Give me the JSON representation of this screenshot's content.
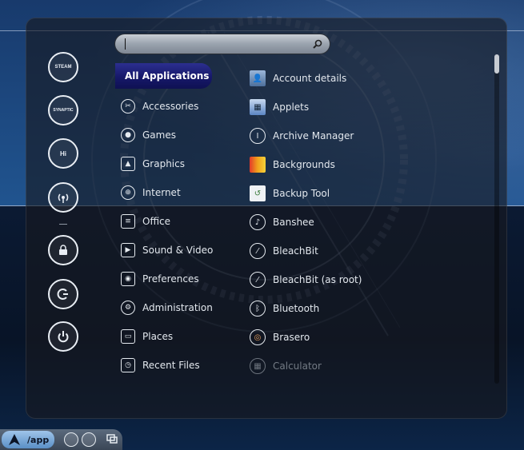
{
  "search": {
    "value": "",
    "placeholder": ""
  },
  "categories": [
    {
      "label": "All Applications",
      "icon": "all-apps",
      "selected": true
    },
    {
      "label": "Accessories",
      "icon": "tools-icon"
    },
    {
      "label": "Games",
      "icon": "games-icon"
    },
    {
      "label": "Graphics",
      "icon": "graphics-icon"
    },
    {
      "label": "Internet",
      "icon": "globe-icon"
    },
    {
      "label": "Office",
      "icon": "document-icon"
    },
    {
      "label": "Sound & Video",
      "icon": "media-icon"
    },
    {
      "label": "Preferences",
      "icon": "preferences-icon"
    },
    {
      "label": "Administration",
      "icon": "administration-icon"
    },
    {
      "label": "Places",
      "icon": "folder-icon"
    },
    {
      "label": "Recent Files",
      "icon": "recent-files-icon"
    }
  ],
  "applications": [
    {
      "label": "Account details",
      "icon": "user-account-icon"
    },
    {
      "label": "Applets",
      "icon": "applets-icon"
    },
    {
      "label": "Archive Manager",
      "icon": "archive-icon"
    },
    {
      "label": "Backgrounds",
      "icon": "backgrounds-icon"
    },
    {
      "label": "Backup Tool",
      "icon": "backup-icon"
    },
    {
      "label": "Banshee",
      "icon": "banshee-icon"
    },
    {
      "label": "BleachBit",
      "icon": "bleachbit-icon"
    },
    {
      "label": "BleachBit (as root)",
      "icon": "bleachbit-root-icon"
    },
    {
      "label": "Bluetooth",
      "icon": "bluetooth-icon"
    },
    {
      "label": "Brasero",
      "icon": "brasero-icon"
    },
    {
      "label": "Calculator",
      "icon": "calculator-icon",
      "disabled": true
    }
  ],
  "favorites": [
    {
      "icon": "steam-icon",
      "text": "STEAM"
    },
    {
      "icon": "synaptic-icon",
      "text": "SYNAPTIC"
    },
    {
      "icon": "hexchat-icon",
      "text": "Hi"
    },
    {
      "icon": "network-icon",
      "text": ""
    },
    {
      "icon": "lock-screen-icon",
      "text": ""
    },
    {
      "icon": "logout-icon",
      "text": ""
    },
    {
      "icon": "power-icon",
      "text": ""
    }
  ],
  "taskbar": {
    "start_label": "/app"
  },
  "colors": {
    "selected_category": "#1a1c78",
    "panel": "#16181e",
    "accent": "#5a8fc6"
  }
}
